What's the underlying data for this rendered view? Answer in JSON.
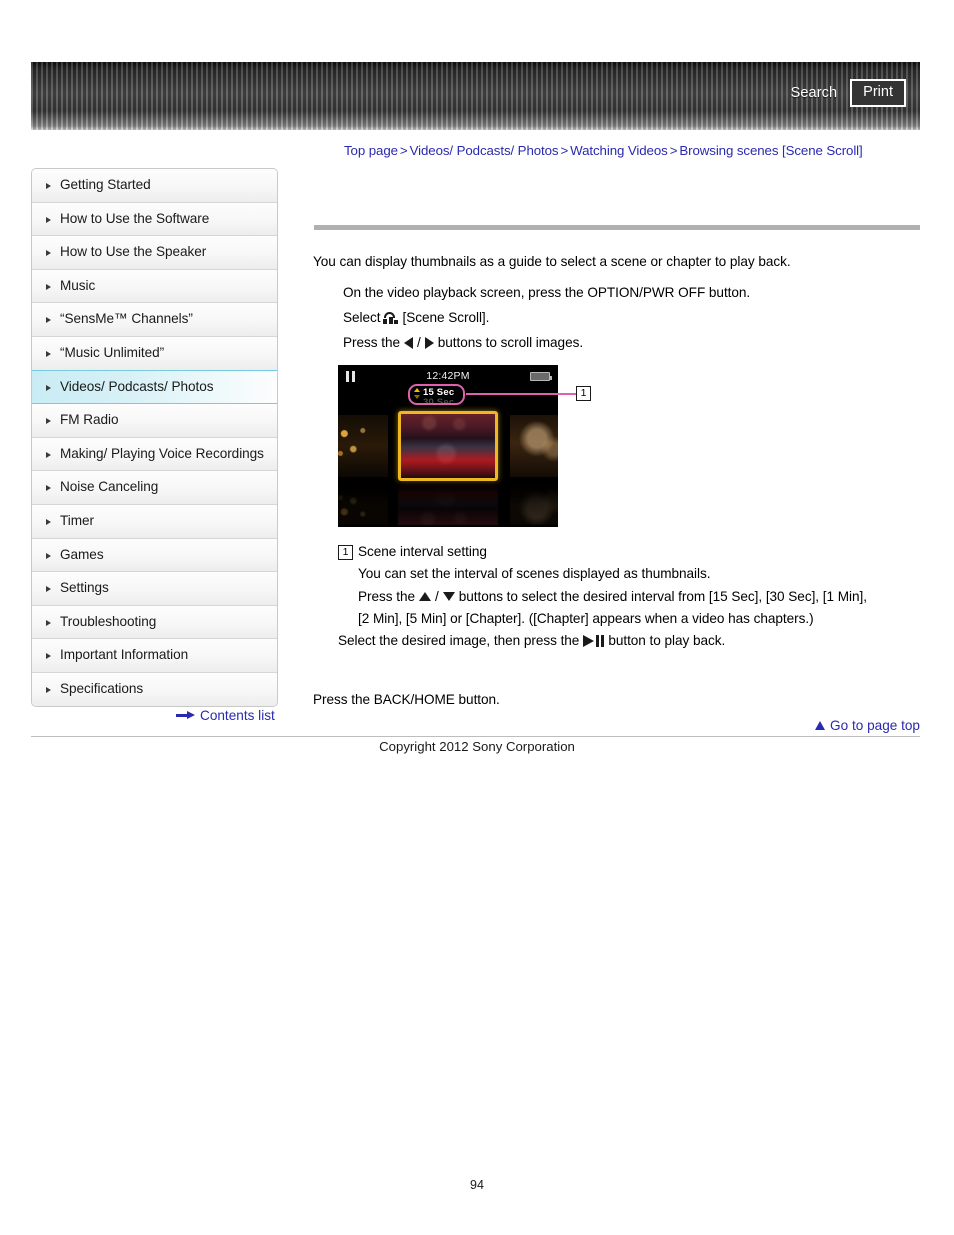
{
  "header": {
    "search_label": "Search",
    "print_label": "Print"
  },
  "breadcrumb": {
    "items": [
      "Top page",
      "Videos/ Podcasts/ Photos",
      "Watching Videos",
      "Browsing scenes [Scene Scroll]"
    ],
    "separator": ">"
  },
  "sidebar": {
    "items": [
      {
        "label": "Getting Started",
        "active": false
      },
      {
        "label": "How to Use the Software",
        "active": false
      },
      {
        "label": "How to Use the Speaker",
        "active": false
      },
      {
        "label": "Music",
        "active": false
      },
      {
        "label": "“SensMe™ Channels”",
        "active": false
      },
      {
        "label": "“Music Unlimited”",
        "active": false
      },
      {
        "label": "Videos/ Podcasts/ Photos",
        "active": true
      },
      {
        "label": "FM Radio",
        "active": false
      },
      {
        "label": "Making/ Playing Voice Recordings",
        "active": false
      },
      {
        "label": "Noise Canceling",
        "active": false
      },
      {
        "label": "Timer",
        "active": false
      },
      {
        "label": "Games",
        "active": false
      },
      {
        "label": "Settings",
        "active": false
      },
      {
        "label": "Troubleshooting",
        "active": false
      },
      {
        "label": "Important Information",
        "active": false
      },
      {
        "label": "Specifications",
        "active": false
      }
    ],
    "contents_list_label": "Contents list"
  },
  "main": {
    "intro": "You can display thumbnails as a guide to select a scene or chapter to play back.",
    "step1": "On the video playback screen, press the OPTION/PWR OFF button.",
    "step2_prefix": "Select",
    "step2_suffix": "[Scene Scroll].",
    "step3_prefix": "Press the",
    "step3_mid": "/",
    "step3_suffix": "buttons to scroll images.",
    "select_line_prefix": "Select the desired image, then press the",
    "select_line_suffix": "button to play back.",
    "back_home_line": "Press the BACK/HOME button.",
    "go_to_top_label": "Go to page top"
  },
  "figure": {
    "callout_number": "1",
    "device_time": "12:42PM",
    "interval_selected": "15 Sec",
    "interval_next": "30 Sec"
  },
  "callout": {
    "number": "1",
    "title": "Scene interval setting",
    "line1": "You can set the interval of scenes displayed as thumbnails.",
    "line2_prefix": "Press the",
    "line2_mid": "/",
    "line2_suffix": "buttons to select the desired interval from [15 Sec], [30 Sec], [1 Min],",
    "line3": "[2 Min], [5 Min] or [Chapter]. ([Chapter] appears when a video has chapters.)"
  },
  "footer": {
    "copyright": "Copyright 2012 Sony Corporation",
    "page_number": "94"
  },
  "colors": {
    "link": "#2a2ab0",
    "accent_pink": "#e05fae",
    "highlight_cyan": "#c9ecf4",
    "thumb_border_gold": "#f0b820"
  }
}
